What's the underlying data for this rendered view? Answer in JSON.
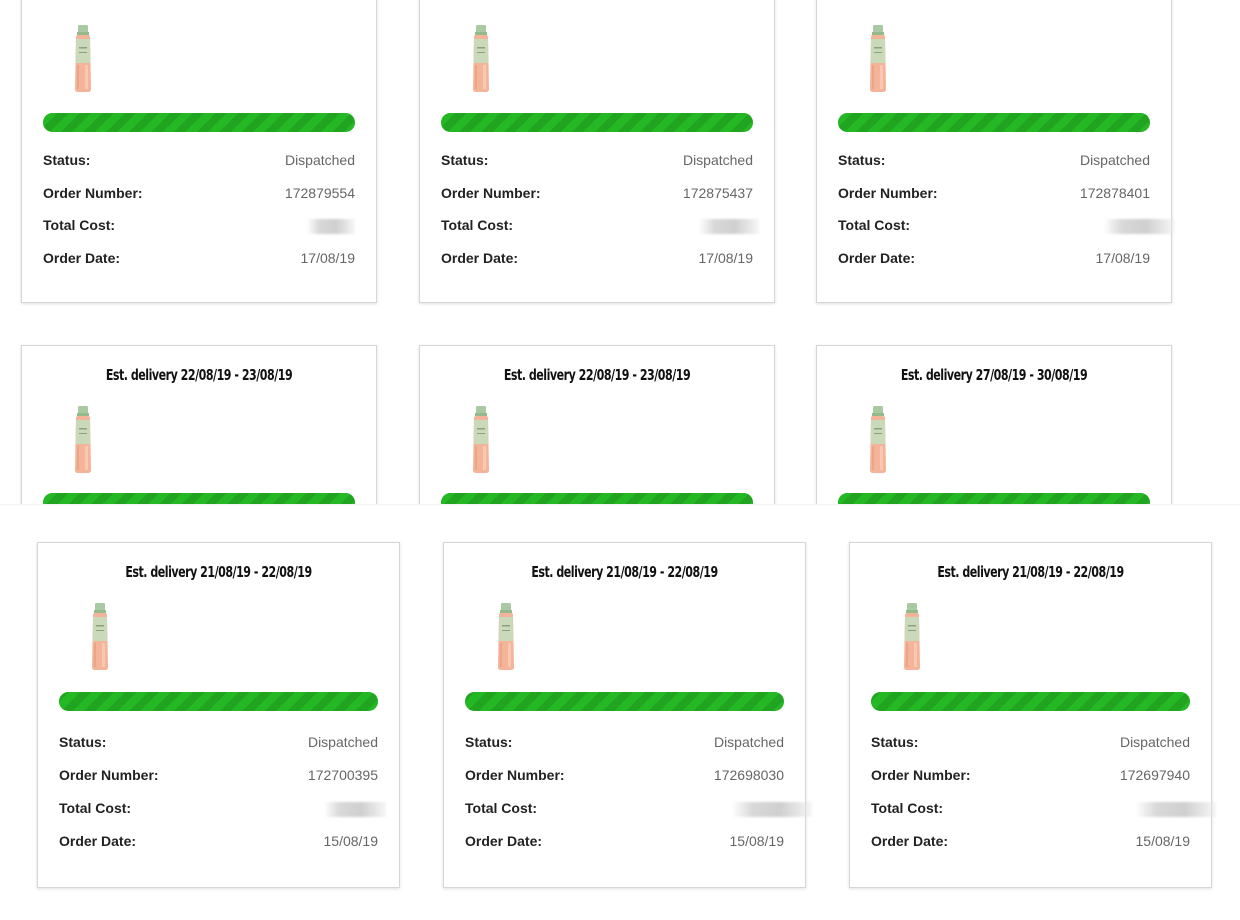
{
  "colors": {
    "progress_green": "#25b825",
    "border": "#d6d6d6",
    "label": "#222222",
    "value": "#666666"
  },
  "labels": {
    "status": "Status:",
    "order_number": "Order Number:",
    "total_cost": "Total Cost:",
    "order_date": "Order Date:"
  },
  "top_row": [
    {
      "status": "Dispatched",
      "order_number": "172879554",
      "total_cost": "",
      "order_date": "17/08/19",
      "progress": 1.0,
      "icon": "toner-bottle-icon"
    },
    {
      "status": "Dispatched",
      "order_number": "172875437",
      "total_cost": "",
      "order_date": "17/08/19",
      "progress": 1.0,
      "icon": "toner-bottle-icon"
    },
    {
      "status": "Dispatched",
      "order_number": "172878401",
      "total_cost": "",
      "order_date": "17/08/19",
      "progress": 1.0,
      "icon": "toner-bottle-icon"
    }
  ],
  "middle_row": [
    {
      "delivery": "Est. delivery 22/08/19 - 23/08/19",
      "progress": 1.0,
      "icon": "toner-bottle-icon"
    },
    {
      "delivery": "Est. delivery 22/08/19 - 23/08/19",
      "progress": 1.0,
      "icon": "toner-bottle-icon"
    },
    {
      "delivery": "Est. delivery 27/08/19 - 30/08/19",
      "progress": 1.0,
      "icon": "toner-bottle-icon"
    }
  ],
  "bottom_row": [
    {
      "delivery": "Est. delivery 21/08/19 - 22/08/19",
      "status": "Dispatched",
      "order_number": "172700395",
      "total_cost": "",
      "order_date": "15/08/19",
      "progress": 1.0,
      "icon": "toner-bottle-icon"
    },
    {
      "delivery": "Est. delivery 21/08/19 - 22/08/19",
      "status": "Dispatched",
      "order_number": "172698030",
      "total_cost": "",
      "order_date": "15/08/19",
      "progress": 1.0,
      "icon": "toner-bottle-icon"
    },
    {
      "delivery": "Est. delivery 21/08/19 - 22/08/19",
      "status": "Dispatched",
      "order_number": "172697940",
      "total_cost": "",
      "order_date": "15/08/19",
      "progress": 1.0,
      "icon": "toner-bottle-icon"
    }
  ]
}
